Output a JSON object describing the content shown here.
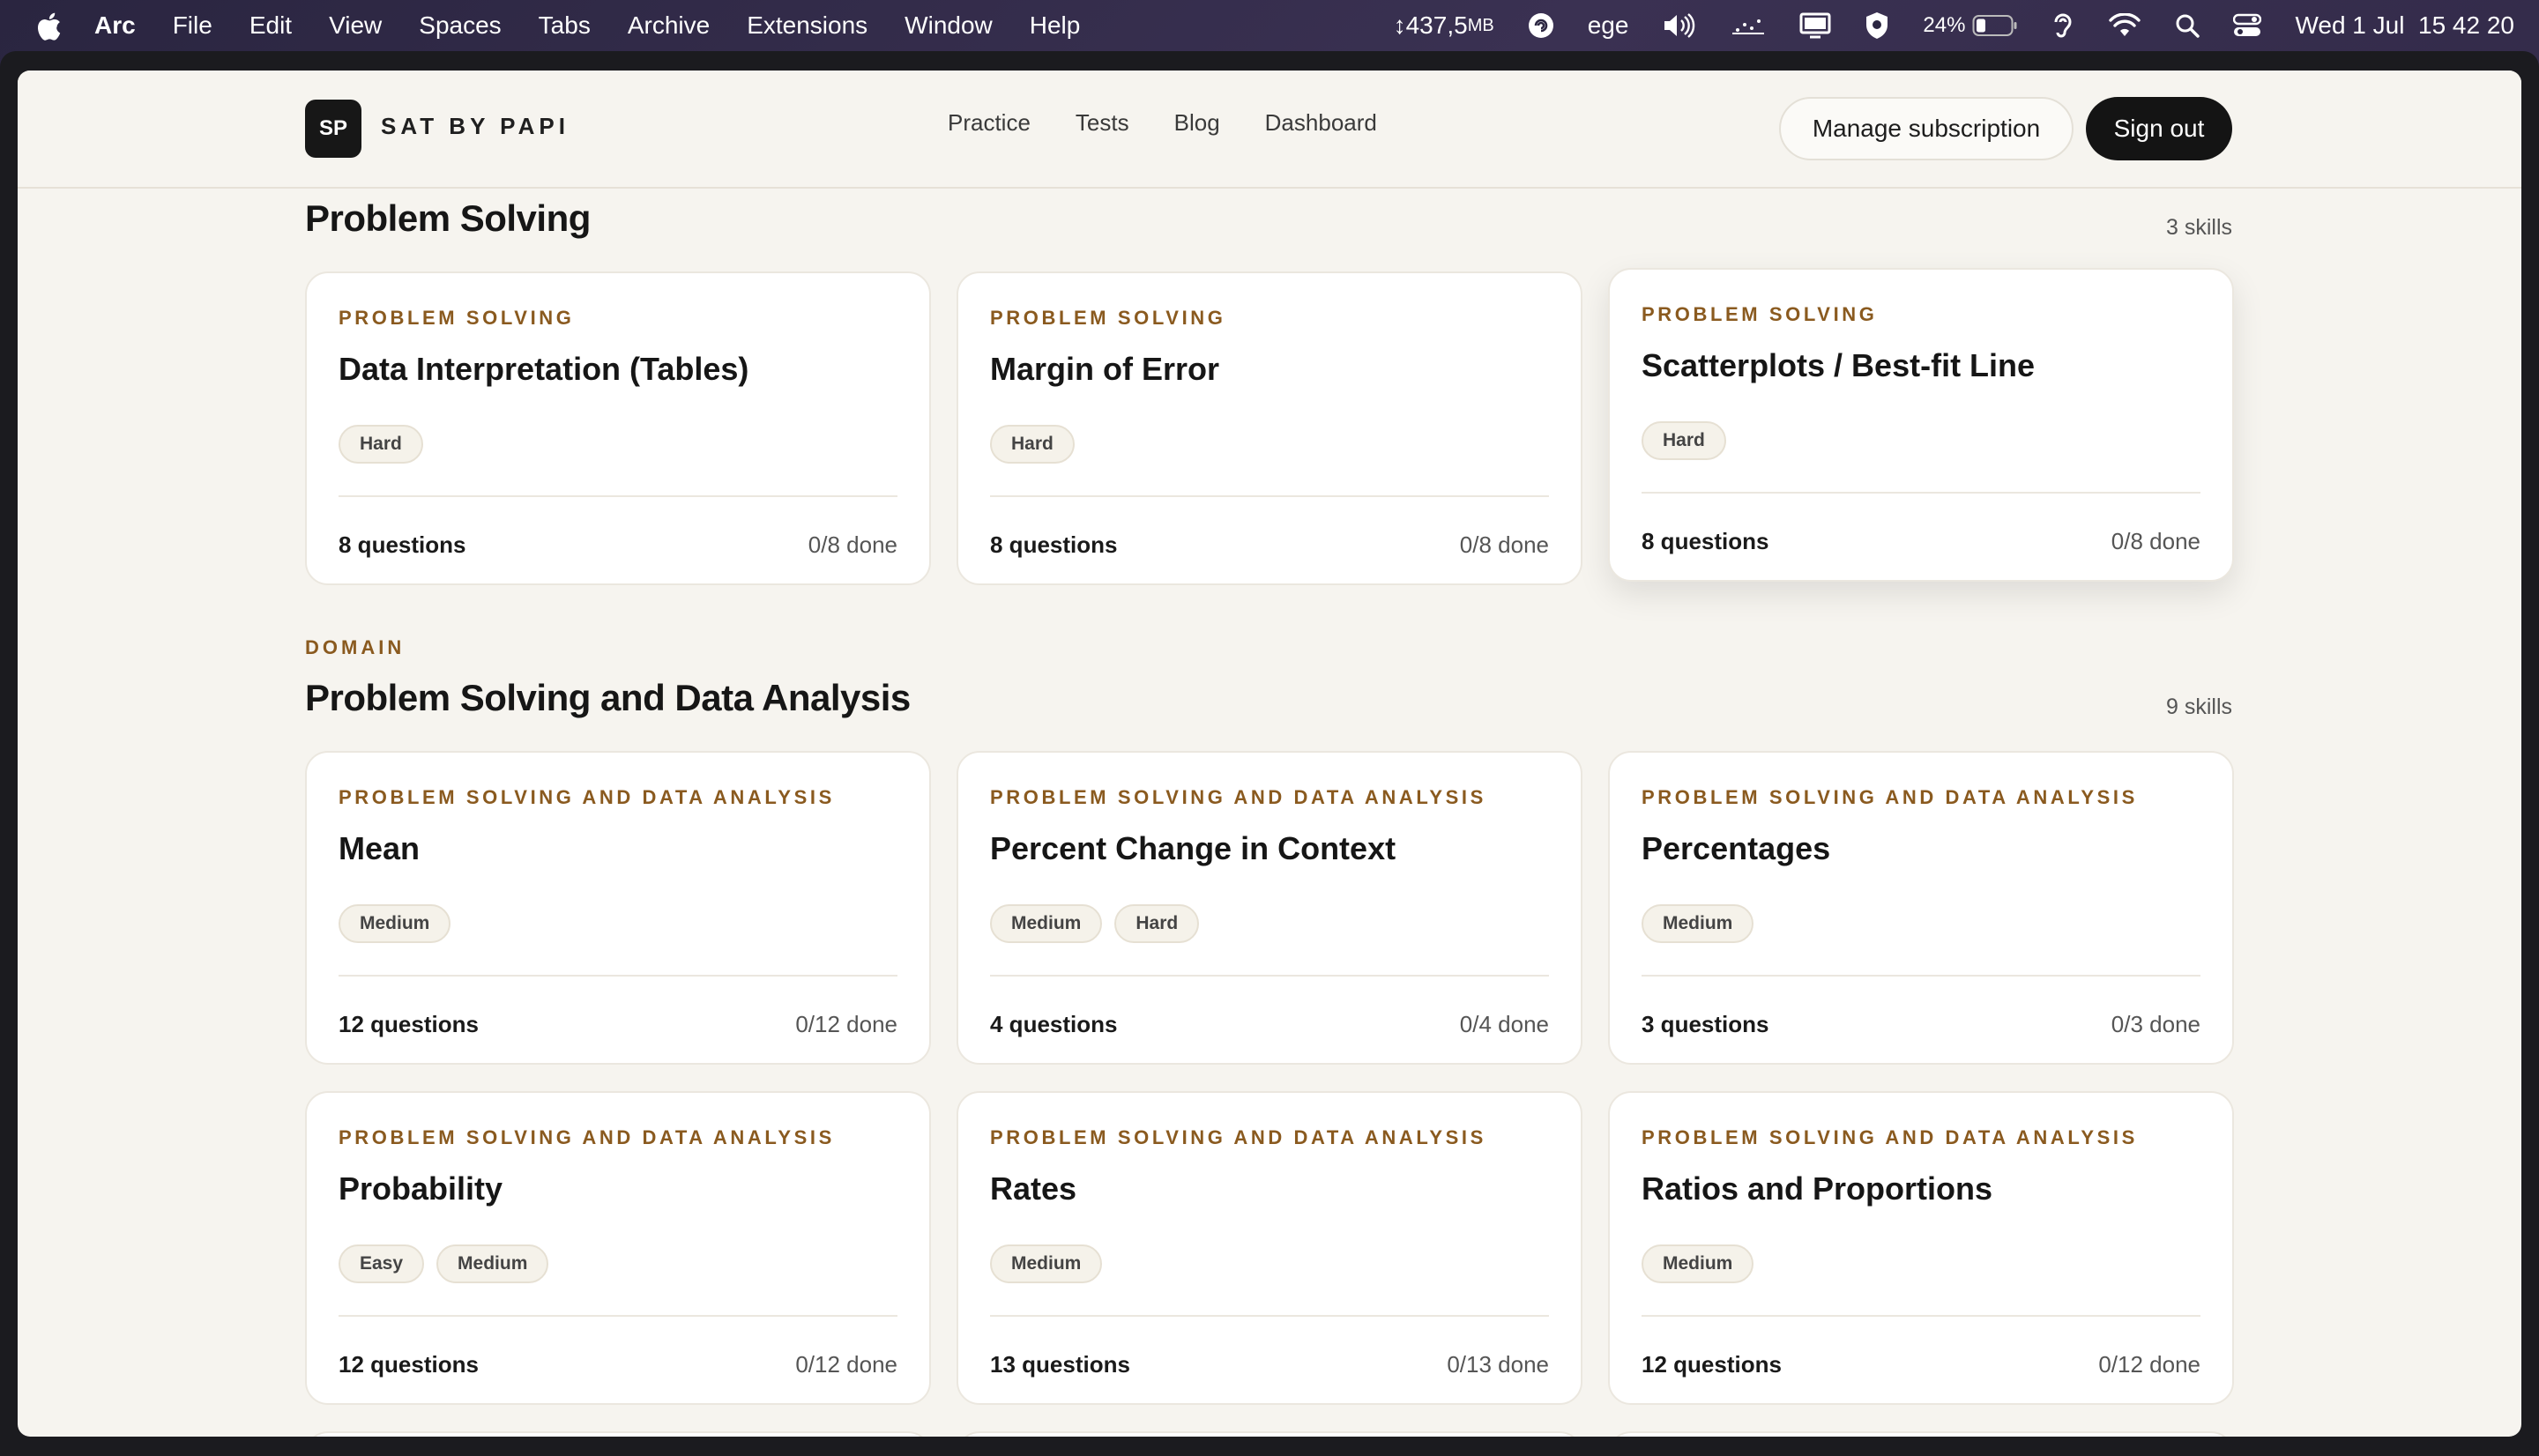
{
  "menubar": {
    "app_name": "Arc",
    "menus": [
      "File",
      "Edit",
      "View",
      "Spaces",
      "Tabs",
      "Archive",
      "Extensions",
      "Window",
      "Help"
    ],
    "memory_value": "↕437,5",
    "memory_unit": "MB",
    "keyboard_layout": "ege",
    "battery_percent": "24%",
    "datetime": "Wed 1 Jul  15 42 20"
  },
  "site": {
    "logo_initials": "SP",
    "brand": "SAT BY PAPI",
    "nav": [
      "Practice",
      "Tests",
      "Blog",
      "Dashboard"
    ],
    "manage_label": "Manage subscription",
    "signout_label": "Sign out"
  },
  "sections": [
    {
      "domain_label": "",
      "title": "Problem Solving",
      "skill_count": "3 skills",
      "cards": [
        {
          "category": "PROBLEM SOLVING",
          "title": "Data Interpretation (Tables)",
          "tags": [
            "Hard"
          ],
          "questions": "8 questions",
          "done": "0/8 done"
        },
        {
          "category": "PROBLEM SOLVING",
          "title": "Margin of Error",
          "tags": [
            "Hard"
          ],
          "questions": "8 questions",
          "done": "0/8 done"
        },
        {
          "category": "PROBLEM SOLVING",
          "title": "Scatterplots / Best-fit Line",
          "tags": [
            "Hard"
          ],
          "questions": "8 questions",
          "done": "0/8 done"
        }
      ]
    },
    {
      "domain_label": "DOMAIN",
      "title": "Problem Solving and Data Analysis",
      "skill_count": "9 skills",
      "cards": [
        {
          "category": "PROBLEM SOLVING AND DATA ANALYSIS",
          "title": "Mean",
          "tags": [
            "Medium"
          ],
          "questions": "12 questions",
          "done": "0/12 done"
        },
        {
          "category": "PROBLEM SOLVING AND DATA ANALYSIS",
          "title": "Percent Change in Context",
          "tags": [
            "Medium",
            "Hard"
          ],
          "questions": "4 questions",
          "done": "0/4 done"
        },
        {
          "category": "PROBLEM SOLVING AND DATA ANALYSIS",
          "title": "Percentages",
          "tags": [
            "Medium"
          ],
          "questions": "3 questions",
          "done": "0/3 done"
        },
        {
          "category": "PROBLEM SOLVING AND DATA ANALYSIS",
          "title": "Probability",
          "tags": [
            "Easy",
            "Medium"
          ],
          "questions": "12 questions",
          "done": "0/12 done"
        },
        {
          "category": "PROBLEM SOLVING AND DATA ANALYSIS",
          "title": "Rates",
          "tags": [
            "Medium"
          ],
          "questions": "13 questions",
          "done": "0/13 done"
        },
        {
          "category": "PROBLEM SOLVING AND DATA ANALYSIS",
          "title": "Ratios and Proportions",
          "tags": [
            "Medium"
          ],
          "questions": "12 questions",
          "done": "0/12 done"
        }
      ]
    }
  ]
}
